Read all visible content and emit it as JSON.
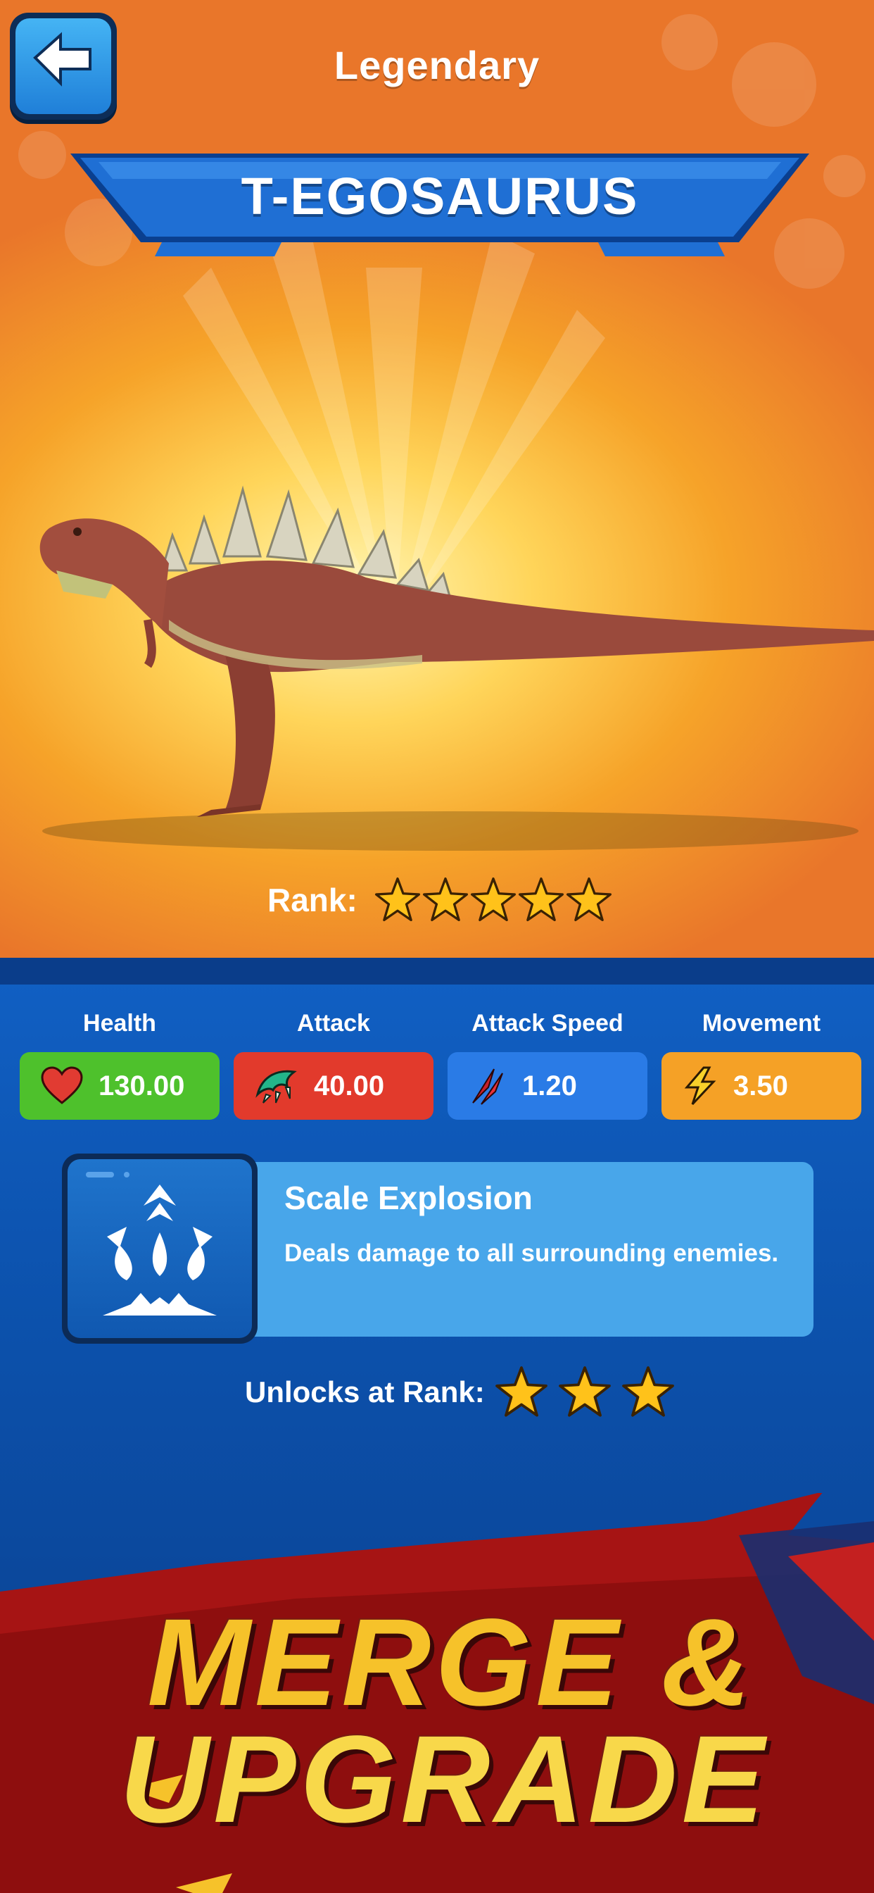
{
  "header": {
    "back_icon": "arrow-left-icon",
    "rarity": "Legendary",
    "name": "T-EGOSAURUS"
  },
  "rank": {
    "label": "Rank:",
    "stars": 5
  },
  "stats": [
    {
      "label": "Health",
      "value": "130.00",
      "icon": "heart-icon",
      "color": "#4ec12c"
    },
    {
      "label": "Attack",
      "value": "40.00",
      "icon": "claw-icon",
      "color": "#e23a2c"
    },
    {
      "label": "Attack Speed",
      "value": "1.20",
      "icon": "slash-icon",
      "color": "#2a7be6"
    },
    {
      "label": "Movement",
      "value": "3.50",
      "icon": "lightning-icon",
      "color": "#f5a126"
    }
  ],
  "ability": {
    "name": "Scale Explosion",
    "description": "Deals damage to all surrounding enemies.",
    "icon": "explosion-icon",
    "unlock_label": "Unlocks at Rank:",
    "unlock_stars": 3
  },
  "promo": {
    "line1": "MERGE &",
    "line2": "UPGRADE"
  }
}
